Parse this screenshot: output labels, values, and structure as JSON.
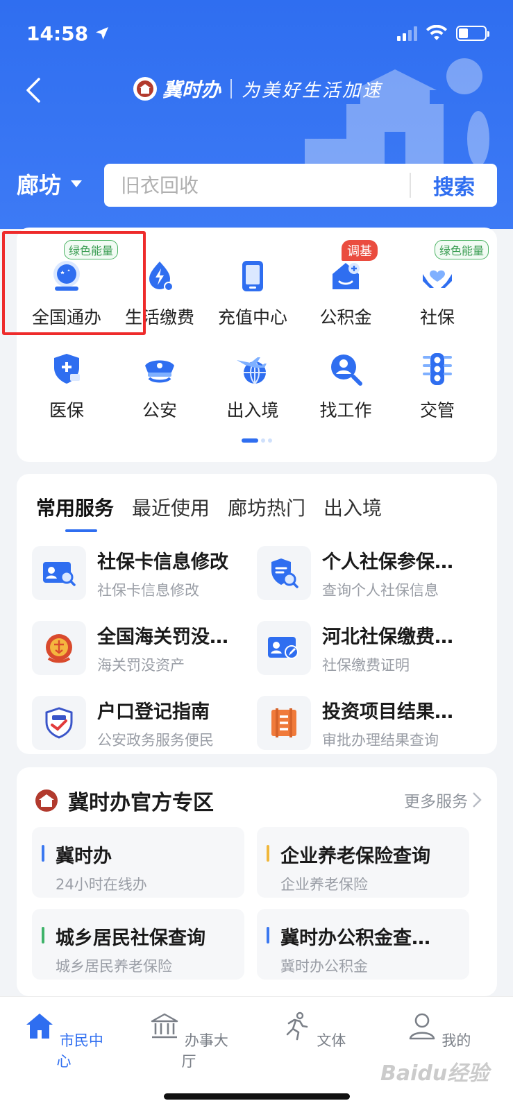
{
  "status_bar": {
    "time": "14:58"
  },
  "header": {
    "brand_name": "冀时办",
    "slogan": "为美好生活加速",
    "city": "廊坊"
  },
  "search": {
    "placeholder": "旧衣回收",
    "button": "搜索"
  },
  "grid": {
    "row1": [
      {
        "label": "全国通办",
        "badge": "绿色能量",
        "badge_style": "green",
        "icon": "globe-service-icon"
      },
      {
        "label": "生活缴费",
        "badge": "",
        "icon": "electricity-icon"
      },
      {
        "label": "充值中心",
        "badge": "",
        "icon": "tablet-icon"
      },
      {
        "label": "公积金",
        "badge": "调基",
        "badge_style": "red",
        "icon": "housing-fund-icon"
      },
      {
        "label": "社保",
        "badge": "绿色能量",
        "badge_style": "green",
        "icon": "social-security-icon"
      }
    ],
    "row2": [
      {
        "label": "医保",
        "icon": "medical-insurance-icon"
      },
      {
        "label": "公安",
        "icon": "police-cap-icon"
      },
      {
        "label": "出入境",
        "icon": "plane-globe-icon"
      },
      {
        "label": "找工作",
        "icon": "job-search-icon"
      },
      {
        "label": "交管",
        "icon": "traffic-light-icon"
      }
    ]
  },
  "services": {
    "tabs": [
      "常用服务",
      "最近使用",
      "廊坊热门",
      "出入境"
    ],
    "items": [
      {
        "title": "社保卡信息修改",
        "sub": "社保卡信息修改",
        "icon": "id-card-search-icon"
      },
      {
        "title": "个人社保参保…",
        "sub": "查询个人社保信息",
        "icon": "shield-doc-search-icon"
      },
      {
        "title": "全国海关罚没…",
        "sub": "海关罚没资产",
        "icon": "customs-emblem-icon"
      },
      {
        "title": "河北社保缴费…",
        "sub": "社保缴费证明",
        "icon": "id-card-edit-icon"
      },
      {
        "title": "户口登记指南",
        "sub": "公安政务服务便民",
        "icon": "police-badge-icon"
      },
      {
        "title": "投资项目结果…",
        "sub": "审批办理结果查询",
        "icon": "project-doc-icon"
      }
    ]
  },
  "official": {
    "title": "冀时办官方专区",
    "more": "更多服务",
    "tiles": [
      {
        "title": "冀时办",
        "sub": "24小时在线办",
        "color": "#3b78f0"
      },
      {
        "title": "企业养老保险查询",
        "sub": "企业养老保险",
        "color": "#f0b73b"
      },
      {
        "title": "城乡居民社保查询",
        "sub": "城乡居民养老保险",
        "color": "#3fb36a"
      },
      {
        "title": "冀时办公积金查…",
        "sub": "冀时办公积金",
        "color": "#3b78f0"
      }
    ]
  },
  "tabbar": [
    {
      "label": "市民中心",
      "icon": "home-icon",
      "active": true
    },
    {
      "label": "办事大厅",
      "icon": "hall-icon",
      "active": false
    },
    {
      "label": "文体",
      "icon": "runner-icon",
      "active": false
    },
    {
      "label": "我的",
      "icon": "user-icon",
      "active": false
    }
  ],
  "watermark": "Baidu经验",
  "colors": {
    "primary": "#2f6ef0",
    "highlight": "#ee2b2b",
    "badge_green": "#4cb364",
    "badge_red": "#ea4c3f"
  }
}
